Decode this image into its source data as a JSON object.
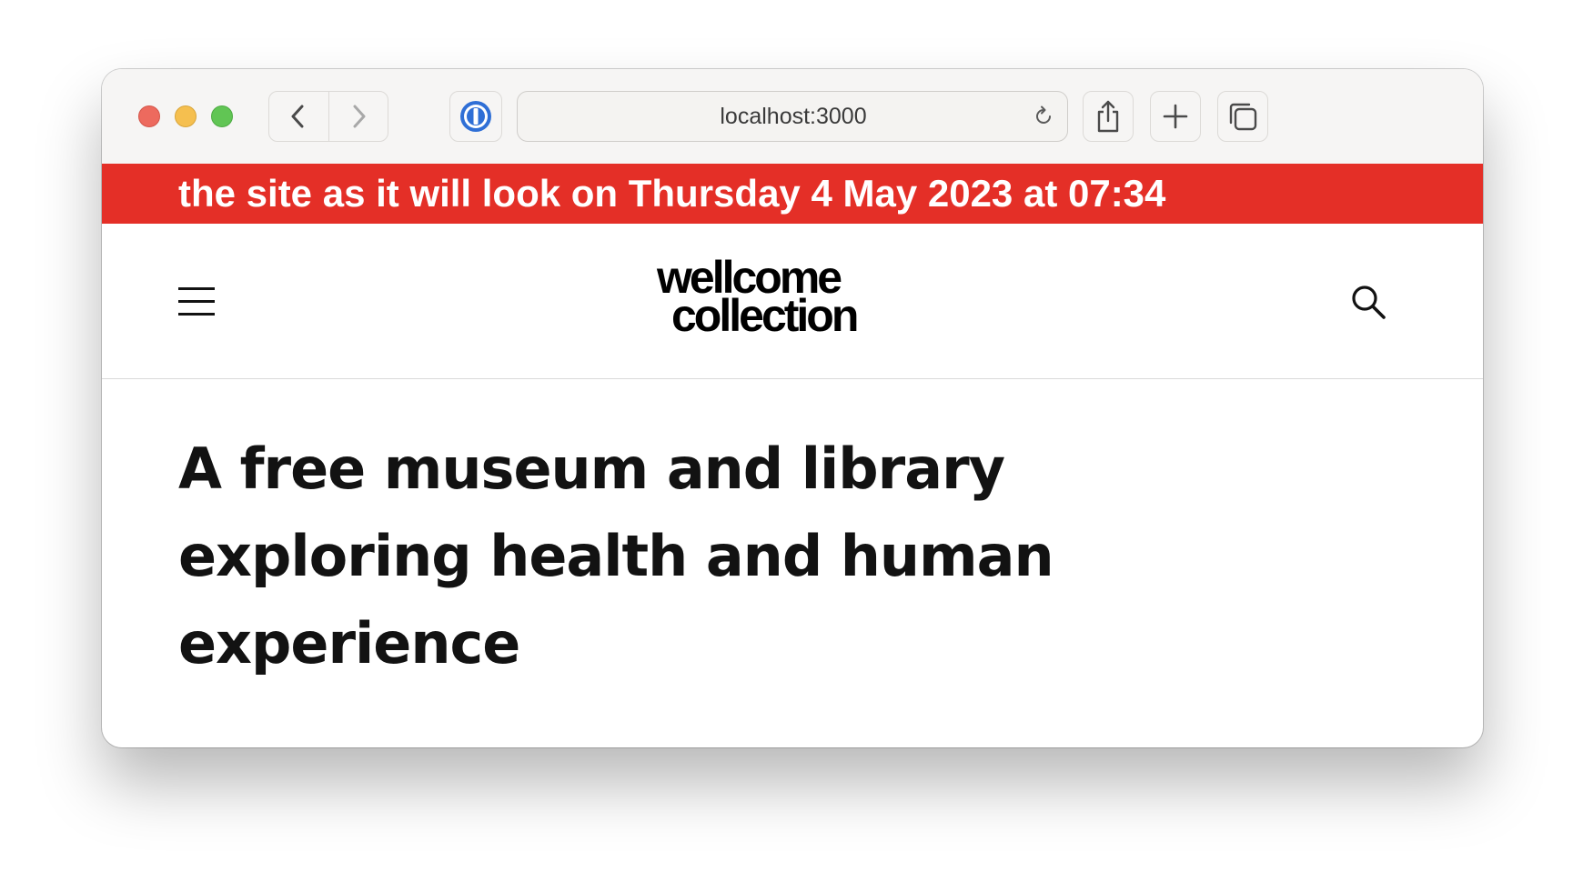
{
  "browser": {
    "url": "localhost:3000",
    "icons": {
      "back": "chevron-left-icon",
      "forward": "chevron-right-icon",
      "extension": "password-manager-icon",
      "reload": "reload-icon",
      "share": "share-icon",
      "new_tab": "plus-icon",
      "tabs": "tab-overview-icon"
    }
  },
  "banner": {
    "text": "the site as it will look on Thursday 4 May 2023 at 07:34",
    "color": "#e42f27"
  },
  "site": {
    "logo_line1": "wellcome",
    "logo_line2": "collection",
    "menu_icon": "hamburger-menu-icon",
    "search_icon": "search-icon",
    "headline": "A free museum and library exploring health and human experience"
  }
}
